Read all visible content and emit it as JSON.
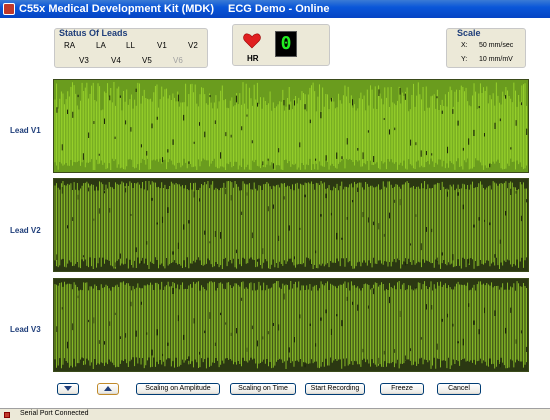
{
  "window": {
    "title": "C55x Medical Development Kit (MDK)",
    "center_title": "ECG Demo - Online"
  },
  "leads_status": {
    "title": "Status Of Leads",
    "row1": [
      "RA",
      "LA",
      "LL",
      "V1",
      "V2"
    ],
    "row2": [
      "V3",
      "V4",
      "V5",
      "V6"
    ],
    "inactive": [
      "V6"
    ]
  },
  "heart_rate": {
    "label": "HR",
    "value": "0",
    "icon": "heart-icon"
  },
  "scale": {
    "title": "Scale",
    "x_label": "X:",
    "x_value": "50 mm/sec",
    "y_label": "Y:",
    "y_value": "10 mm/mV"
  },
  "leads": [
    {
      "name": "Lead V1"
    },
    {
      "name": "Lead V2"
    },
    {
      "name": "Lead V3"
    }
  ],
  "colors": {
    "trace_bright": "#9bd62c",
    "trace_mid": "#6a9c1e",
    "strip_dark": "#2b3812",
    "accent": "#1f3e7a"
  },
  "buttons": {
    "scroll_down_icon": "triangle-down-icon",
    "scroll_up_icon": "triangle-up-icon",
    "scaling_amplitude": "Scaling on Amplitude",
    "scaling_time": "Scaling on Time",
    "start_recording": "Start Recording",
    "freeze": "Freeze",
    "cancel": "Cancel"
  },
  "status": {
    "text": "Serial Port Connected"
  }
}
